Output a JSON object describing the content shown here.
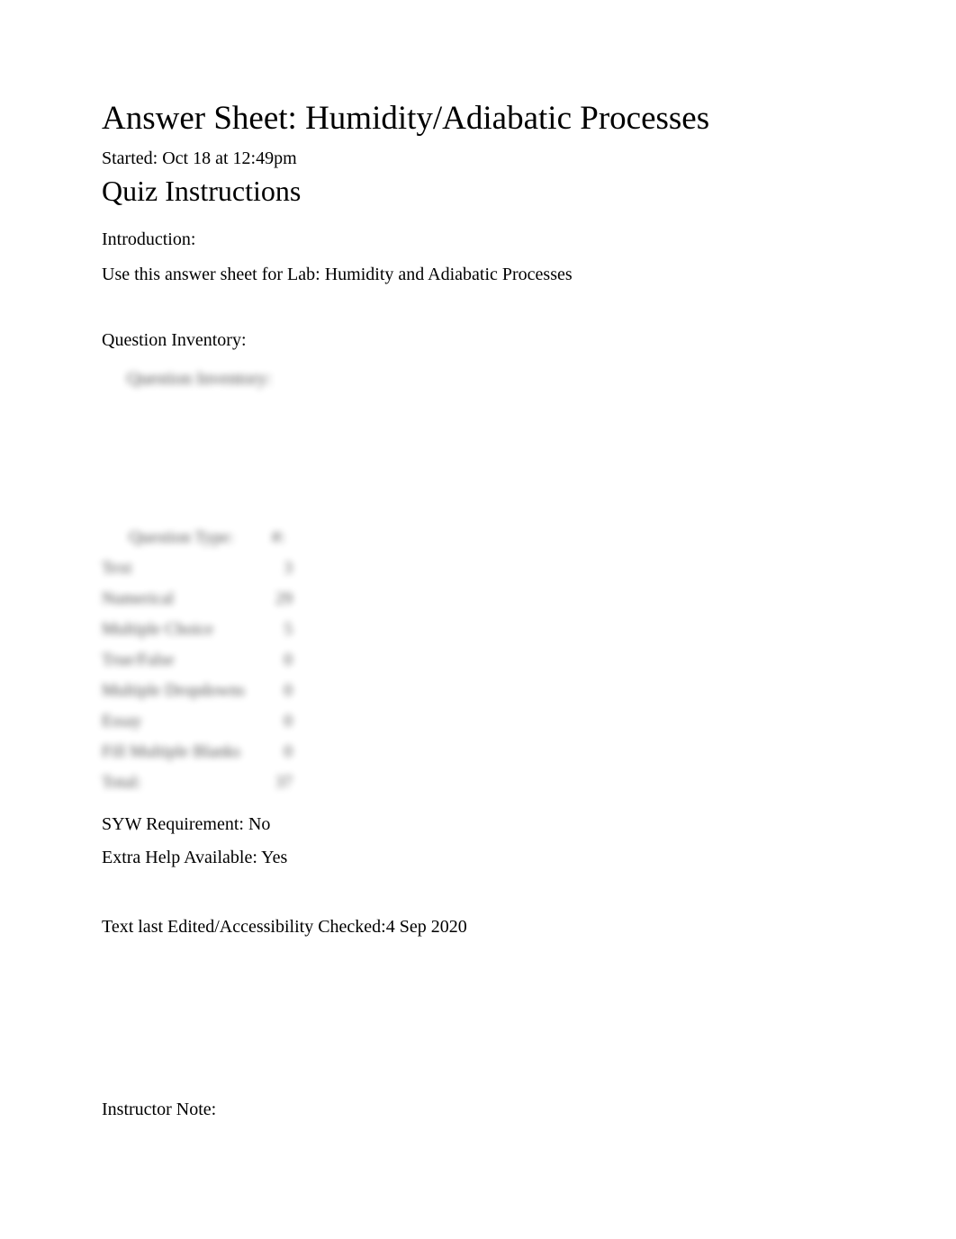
{
  "title": "Answer Sheet: Humidity/Adiabatic Processes",
  "started_line": "Started: Oct 18 at 12:49pm",
  "instructions_heading": "Quiz Instructions",
  "intro_label": "Introduction:",
  "intro_text": "Use this answer sheet for Lab: Humidity and Adiabatic Processes",
  "inventory_label": "Question Inventory:",
  "inventory_caption": "Question Inventory:",
  "table": {
    "headers": {
      "type": "Question Type:",
      "count": "#:"
    },
    "rows": [
      {
        "type": "Text",
        "count": "3"
      },
      {
        "type": "Numerical",
        "count": "29"
      },
      {
        "type": "Multiple Choice",
        "count": "5"
      },
      {
        "type": "True/False",
        "count": "0"
      },
      {
        "type": "Multiple Dropdowns",
        "count": "0"
      },
      {
        "type": "Essay",
        "count": "0"
      },
      {
        "type": "Fill Multiple Blanks",
        "count": "0"
      },
      {
        "type": "Total:",
        "count": "37"
      }
    ]
  },
  "syw_line": "SYW Requirement: No",
  "help_line": "Extra Help Available: Yes",
  "edited_line": "Text last Edited/Accessibility Checked:4 Sep 2020",
  "instructor_note_label": "Instructor Note:"
}
